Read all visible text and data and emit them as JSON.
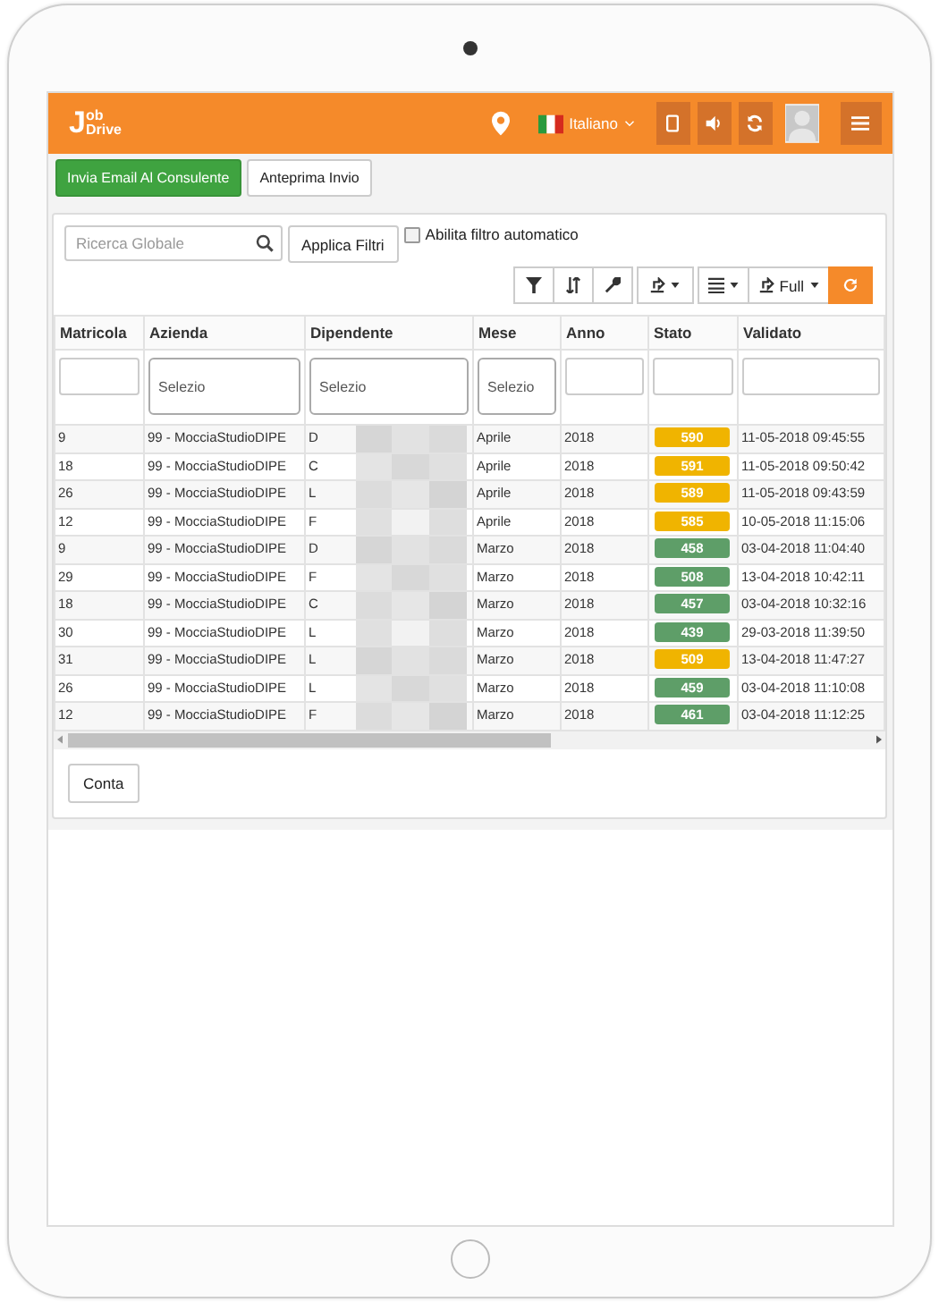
{
  "header": {
    "logo": {
      "initial": "J",
      "top": "ob",
      "bottom": "Drive"
    },
    "language": "Italiano"
  },
  "actions": [
    {
      "label": "Invia Email Al Consulente",
      "kind": "primary"
    },
    {
      "label": "Anteprima Invio",
      "kind": "default"
    }
  ],
  "filters": {
    "search": {
      "placeholder": "Ricerca Globale"
    },
    "apply_button": "Applica Filtri",
    "auto_filter": {
      "label": "Abilita filtro automatico",
      "checked": false
    }
  },
  "toolbar": {
    "export_label": "Full"
  },
  "table": {
    "columns": [
      "Matricola",
      "Azienda",
      "Dipendente",
      "Mese",
      "Anno",
      "Stato",
      "Validato"
    ],
    "column_filters": [
      {
        "kind": "input"
      },
      {
        "kind": "select",
        "placeholder": "Selezio"
      },
      {
        "kind": "select",
        "placeholder": "Selezio"
      },
      {
        "kind": "select",
        "placeholder": "Selezio"
      },
      {
        "kind": "input"
      },
      {
        "kind": "input"
      },
      {
        "kind": "input"
      }
    ],
    "rows": [
      {
        "matricola": "9",
        "azienda": "99 - MocciaStudioDIPE",
        "dipendente": "D",
        "mese": "Aprile",
        "anno": "2018",
        "stato": "590",
        "color": "#f0b400",
        "validato": "11-05-2018 09:45:55"
      },
      {
        "matricola": "18",
        "azienda": "99 - MocciaStudioDIPE",
        "dipendente": "C",
        "mese": "Aprile",
        "anno": "2018",
        "stato": "591",
        "color": "#f0b400",
        "validato": "11-05-2018 09:50:42"
      },
      {
        "matricola": "26",
        "azienda": "99 - MocciaStudioDIPE",
        "dipendente": "L",
        "mese": "Aprile",
        "anno": "2018",
        "stato": "589",
        "color": "#f0b400",
        "validato": "11-05-2018 09:43:59"
      },
      {
        "matricola": "12",
        "azienda": "99 - MocciaStudioDIPE",
        "dipendente": "F",
        "mese": "Aprile",
        "anno": "2018",
        "stato": "585",
        "color": "#f0b400",
        "validato": "10-05-2018 11:15:06"
      },
      {
        "matricola": "9",
        "azienda": "99 - MocciaStudioDIPE",
        "dipendente": "D",
        "mese": "Marzo",
        "anno": "2018",
        "stato": "458",
        "color": "#5e9e68",
        "validato": "03-04-2018 11:04:40"
      },
      {
        "matricola": "29",
        "azienda": "99 - MocciaStudioDIPE",
        "dipendente": "F",
        "mese": "Marzo",
        "anno": "2018",
        "stato": "508",
        "color": "#5e9e68",
        "validato": "13-04-2018 10:42:11"
      },
      {
        "matricola": "18",
        "azienda": "99 - MocciaStudioDIPE",
        "dipendente": "C",
        "mese": "Marzo",
        "anno": "2018",
        "stato": "457",
        "color": "#5e9e68",
        "validato": "03-04-2018 10:32:16"
      },
      {
        "matricola": "30",
        "azienda": "99 - MocciaStudioDIPE",
        "dipendente": "L",
        "mese": "Marzo",
        "anno": "2018",
        "stato": "439",
        "color": "#5e9e68",
        "validato": "29-03-2018 11:39:50"
      },
      {
        "matricola": "31",
        "azienda": "99 - MocciaStudioDIPE",
        "dipendente": "L",
        "mese": "Marzo",
        "anno": "2018",
        "stato": "509",
        "color": "#f0b400",
        "validato": "13-04-2018 11:47:27"
      },
      {
        "matricola": "26",
        "azienda": "99 - MocciaStudioDIPE",
        "dipendente": "L",
        "mese": "Marzo",
        "anno": "2018",
        "stato": "459",
        "color": "#5e9e68",
        "validato": "03-04-2018 11:10:08"
      },
      {
        "matricola": "12",
        "azienda": "99 - MocciaStudioDIPE",
        "dipendente": "F",
        "mese": "Marzo",
        "anno": "2018",
        "stato": "461",
        "color": "#5e9e68",
        "validato": "03-04-2018 11:12:25"
      }
    ]
  },
  "footer_button": "Conta"
}
